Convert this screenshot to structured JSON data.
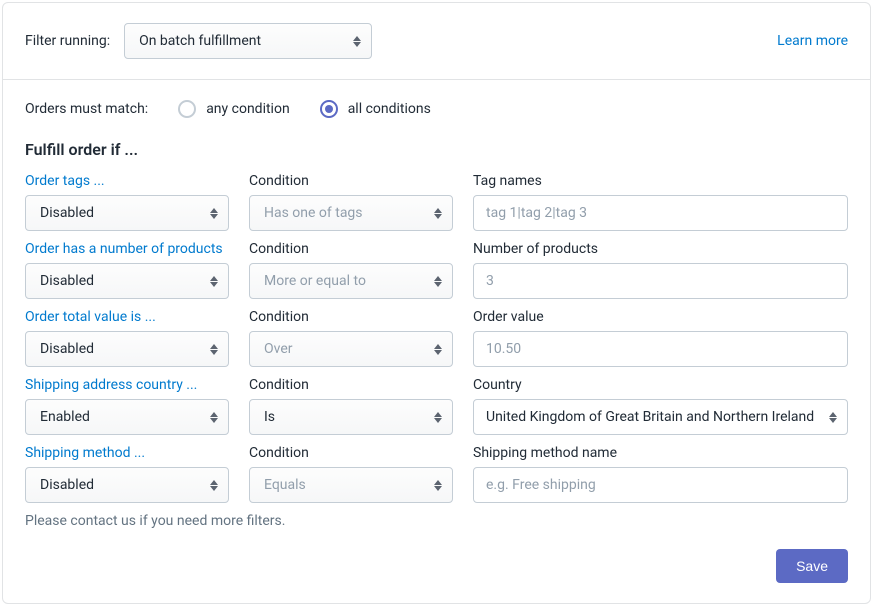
{
  "header": {
    "filter_running_label": "Filter running:",
    "filter_running_value": "On batch fulfillment",
    "learn_more": "Learn more"
  },
  "match": {
    "label": "Orders must match:",
    "any": "any condition",
    "all": "all conditions",
    "selected": "all"
  },
  "section_title": "Fulfill order if ...",
  "rules": [
    {
      "name": "Order tags ...",
      "state": "Disabled",
      "cond_label": "Condition",
      "cond_value": "Has one of tags",
      "cond_dim": true,
      "value_label": "Tag names",
      "value_placeholder": "tag 1|tag 2|tag 3",
      "value_type": "input"
    },
    {
      "name": "Order has a number of products",
      "state": "Disabled",
      "cond_label": "Condition",
      "cond_value": "More or equal to",
      "cond_dim": true,
      "value_label": "Number of products",
      "value_placeholder": "3",
      "value_type": "input"
    },
    {
      "name": "Order total value is ...",
      "state": "Disabled",
      "cond_label": "Condition",
      "cond_value": "Over",
      "cond_dim": true,
      "value_label": "Order value",
      "value_placeholder": "10.50",
      "value_type": "input"
    },
    {
      "name": "Shipping address country ...",
      "state": "Enabled",
      "cond_label": "Condition",
      "cond_value": "Is",
      "cond_dim": false,
      "value_label": "Country",
      "value_placeholder": "United Kingdom of Great Britain and Northern Ireland",
      "value_type": "select"
    },
    {
      "name": "Shipping method ...",
      "state": "Disabled",
      "cond_label": "Condition",
      "cond_value": "Equals",
      "cond_dim": true,
      "value_label": "Shipping method name",
      "value_placeholder": "e.g. Free shipping",
      "value_type": "input"
    }
  ],
  "helper": "Please contact us if you need more filters.",
  "save_label": "Save"
}
